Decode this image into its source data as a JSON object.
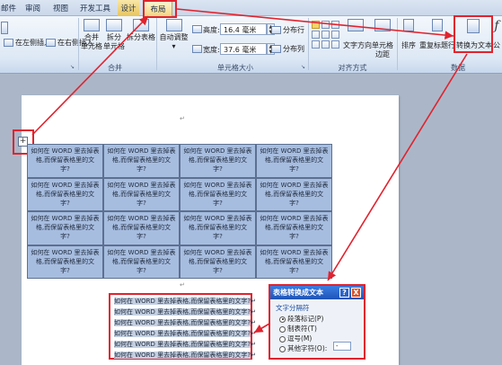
{
  "tabs": [
    {
      "label": "邮件"
    },
    {
      "label": "审阅"
    },
    {
      "label": "视图"
    },
    {
      "label": "开发工具"
    },
    {
      "label": "设计"
    },
    {
      "label": "布局"
    }
  ],
  "ribbon": {
    "rows_cols": {
      "insert_left": "在左侧插入",
      "insert_right": "在右侧插入"
    },
    "merge": {
      "merge_cells": "合并\n单元格",
      "split_cells": "拆分\n单元格",
      "split_table": "拆分表格",
      "label": "合并"
    },
    "autofit": {
      "label": "自动调整"
    },
    "cell_size": {
      "height_label": "高度:",
      "height_value": "16.4 毫米",
      "width_label": "宽度:",
      "width_value": "37.6 毫米",
      "dist_rows": "分布行",
      "dist_cols": "分布列",
      "label": "单元格大小"
    },
    "alignment": {
      "text_direction": "文字方向",
      "cell_margins": "单元格\n边距",
      "label": "对齐方式"
    },
    "data": {
      "sort": "排序",
      "repeat_header": "重复标题行",
      "convert_to_text": "转换为文本",
      "formula": "公",
      "label": "数据"
    }
  },
  "document": {
    "cell_text": "如何在 WORD 里去掉表格,而保留表格里的文字?",
    "cell_line1": "如何在 WORD 里去掉表",
    "cell_line2": "格,而保留表格里的文",
    "cell_line3": "字?",
    "text_line": "如何在 WORD 里去掉表格,而保留表格里的文字?"
  },
  "dialog": {
    "title": "表格转换成文本",
    "help": "?",
    "close": "X",
    "group_label": "文字分隔符",
    "options": [
      {
        "label": "段落标记(P)",
        "selected": true
      },
      {
        "label": "制表符(T)",
        "selected": false
      },
      {
        "label": "逗号(M)",
        "selected": false
      },
      {
        "label": "其他字符(O):",
        "selected": false
      }
    ],
    "other_value": "-"
  },
  "colors": {
    "annotation_red": "#e0232e",
    "table_selection": "#a7bde0"
  }
}
